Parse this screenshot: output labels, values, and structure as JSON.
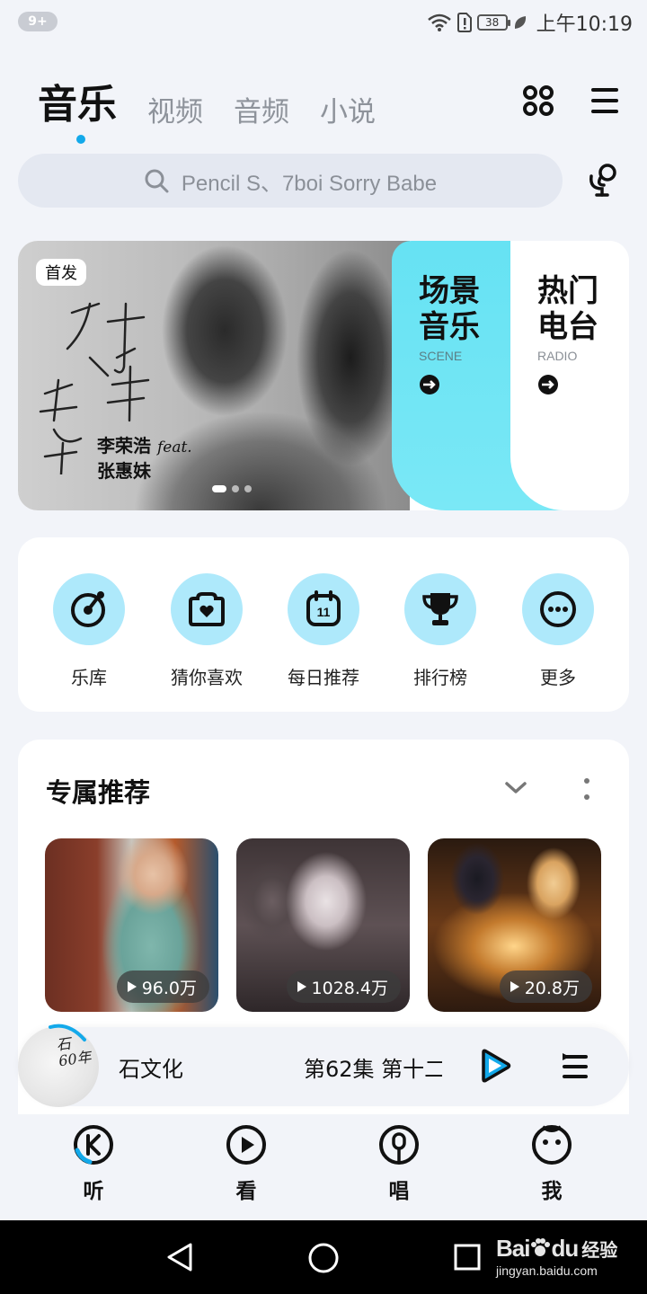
{
  "status_bar": {
    "notification_badge": "9+",
    "battery": "38",
    "time": "上午10:19"
  },
  "top_tabs": [
    {
      "label": "音乐",
      "active": true
    },
    {
      "label": "视频",
      "active": false
    },
    {
      "label": "音频",
      "active": false
    },
    {
      "label": "小说",
      "active": false
    }
  ],
  "search": {
    "placeholder": "Pencil S、7boi Sorry Babe"
  },
  "banner": {
    "badge": "首发",
    "artist_line1": "李荣浩",
    "feat": "feat.",
    "artist_line2": "张惠妹",
    "active_dot": 1,
    "dot_count": 3,
    "scene": {
      "title_line1": "场景",
      "title_line2": "音乐",
      "subtitle": "SCENE"
    },
    "radio": {
      "title_line1": "热门",
      "title_line2": "电台",
      "subtitle": "RADIO"
    }
  },
  "quick_menu": [
    {
      "label": "乐库",
      "icon": "music-disc-icon"
    },
    {
      "label": "猜你喜欢",
      "icon": "heart-bag-icon"
    },
    {
      "label": "每日推荐",
      "icon": "calendar-icon",
      "day": "11"
    },
    {
      "label": "排行榜",
      "icon": "trophy-icon"
    },
    {
      "label": "更多",
      "icon": "more-dots-icon"
    }
  ],
  "recommend": {
    "title": "专属推荐",
    "cards": [
      {
        "play_count": "96.0万"
      },
      {
        "play_count": "1028.4万"
      },
      {
        "play_count": "20.8万"
      }
    ]
  },
  "player": {
    "cover_text_line1": "石",
    "cover_text_line2": "60年",
    "artist": "石文化",
    "title": "第62集 第十二"
  },
  "bottom_nav": [
    {
      "label": "听",
      "icon": "listen-icon",
      "active": true
    },
    {
      "label": "看",
      "icon": "watch-icon",
      "active": false
    },
    {
      "label": "唱",
      "icon": "sing-icon",
      "active": false
    },
    {
      "label": "我",
      "icon": "me-icon",
      "active": false
    }
  ],
  "watermark": {
    "logo": "Bai",
    "logo_suffix": "du",
    "cn": "经验",
    "url": "jingyan.baidu.com"
  },
  "colors": {
    "accent": "#13a9ea",
    "scene_panel": "#6ae4f4",
    "quick_circle": "#aee9fb"
  }
}
